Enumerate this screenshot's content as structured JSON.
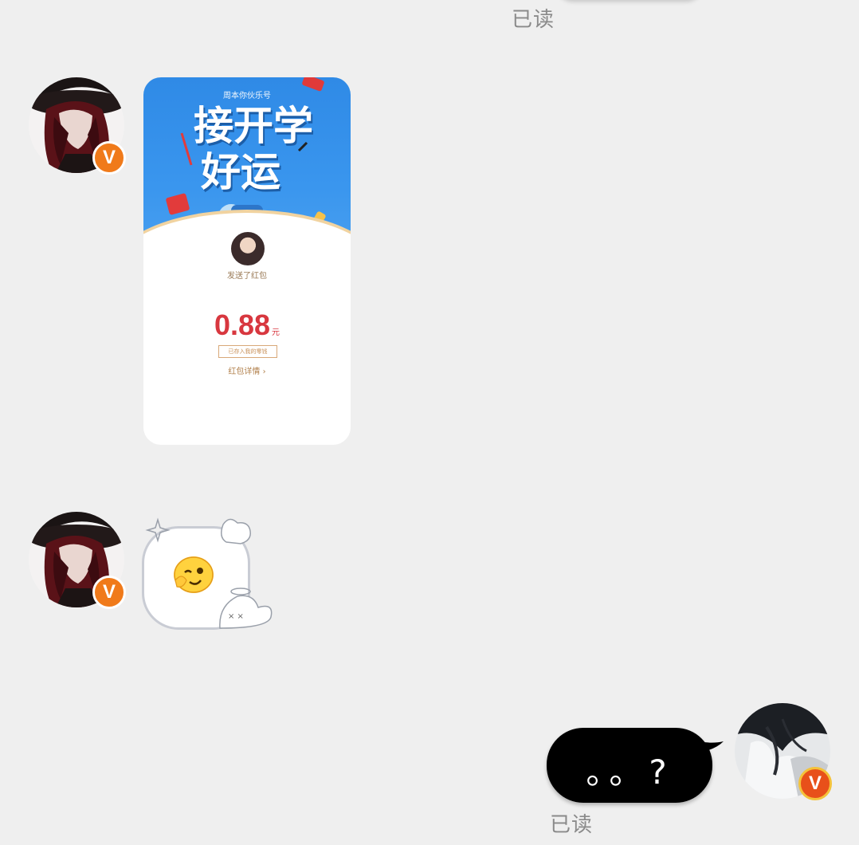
{
  "chat": {
    "read_status_top": "已读",
    "read_status_bottom": "已读",
    "red_packet": {
      "brand": "周本你伙乐号",
      "title_line1": "接开学",
      "title_line2": "好运",
      "sender_name": "发送了红包",
      "amount": "0.88",
      "amount_unit": "元",
      "note": "已存入我的零钱",
      "detail_link": "红包详情 ›"
    },
    "my_message": "。。?",
    "colors": {
      "background": "#efefef",
      "vip_badge": "#f07a1a",
      "red_packet_blue": "#3a96ee",
      "amount_red": "#d8373f",
      "my_bubble": "#000000"
    },
    "icons": {
      "vip_badge": "v-verified-badge",
      "sticker": "wink-salute-emoji"
    },
    "vip_badge_letter": "V"
  }
}
